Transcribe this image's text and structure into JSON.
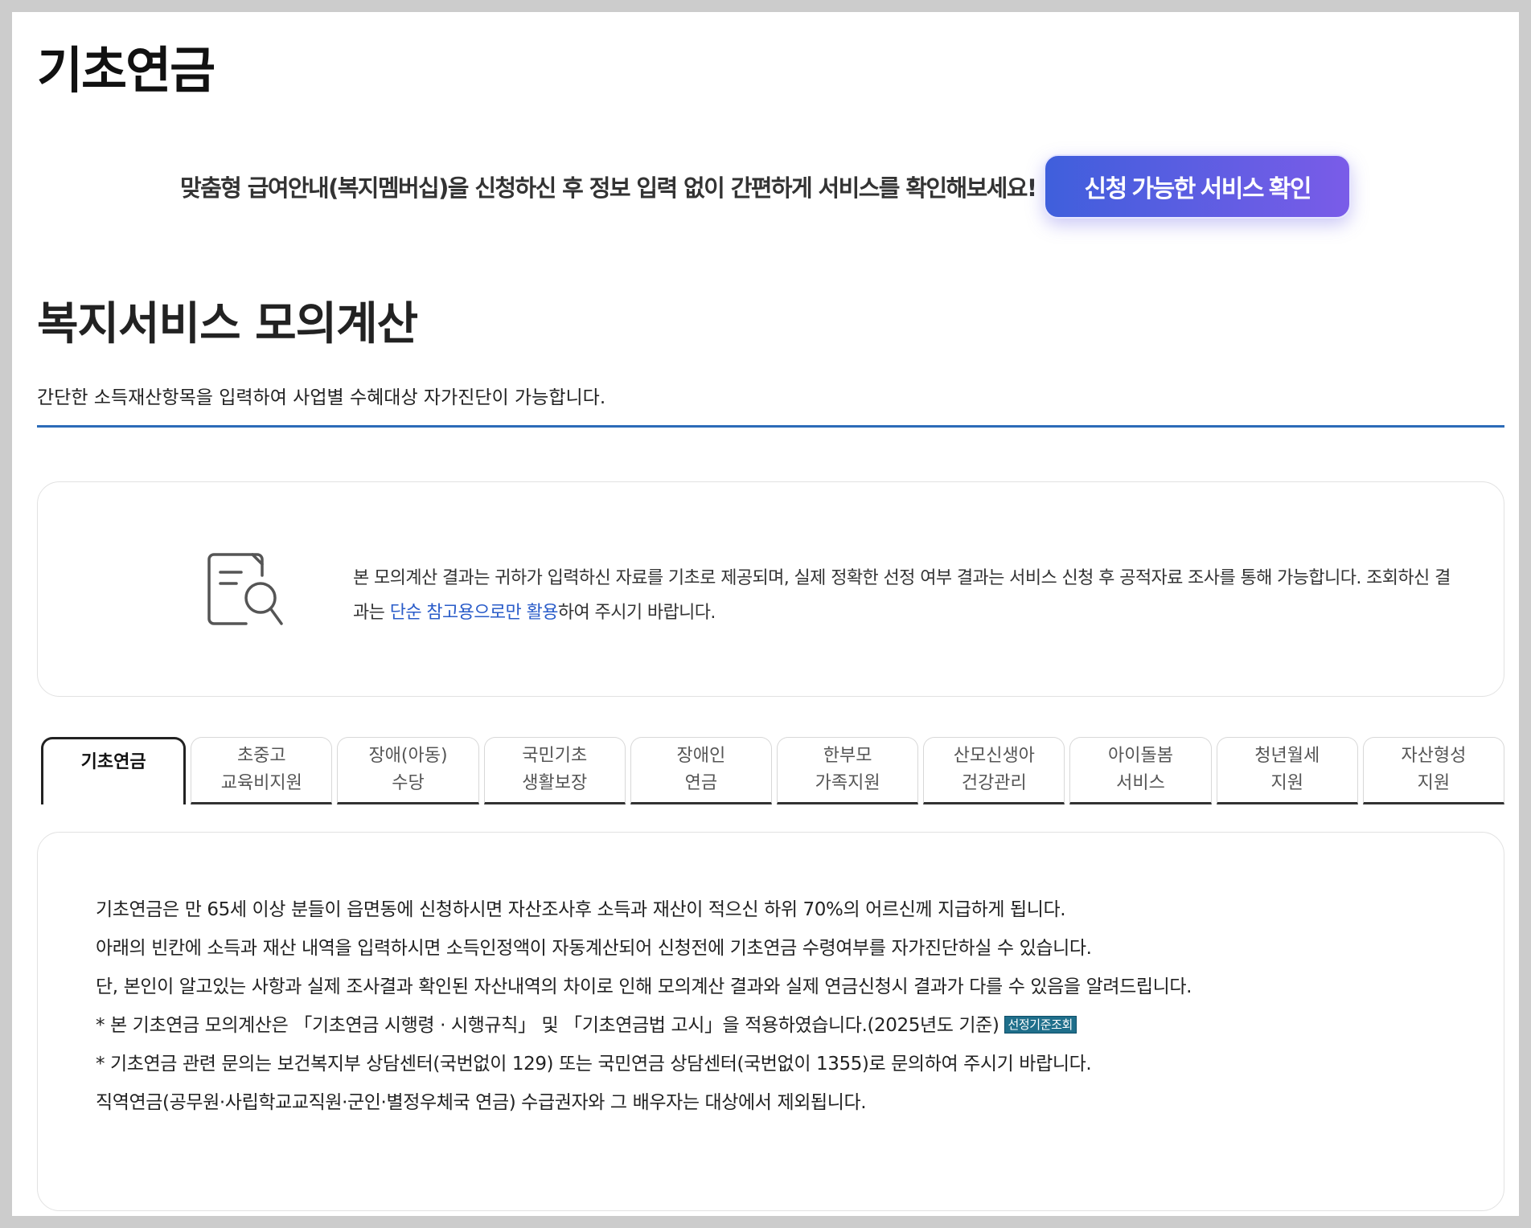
{
  "page": {
    "title": "기초연금"
  },
  "member_banner": {
    "message": "맞춤형 급여안내(복지멤버십)을 신청하신 후 정보 입력 없이 간편하게 서비스를 확인해보세요!",
    "button_label": "신청 가능한 서비스 확인"
  },
  "section": {
    "title": "복지서비스 모의계산",
    "description": "간단한 소득재산항목을 입력하여 사업별 수혜대상 자가진단이 가능합니다."
  },
  "notice": {
    "icon": "document-search-icon",
    "text_before": "본 모의계산 결과는 귀하가 입력하신 자료를 기초로 제공되며, 실제 정확한 선정 여부 결과는 서비스 신청 후 공적자료 조사를 통해 가능합니다. 조회하신 결과는 ",
    "text_highlight": "단순 참고용으로만 활용",
    "text_after": "하여 주시기 바랍니다.",
    "highlight_color": "#2a5cc9"
  },
  "tabs": [
    {
      "label": "기초연금",
      "active": true
    },
    {
      "label": "초중고\n교육비지원",
      "active": false
    },
    {
      "label": "장애(아동)\n수당",
      "active": false
    },
    {
      "label": "국민기초\n생활보장",
      "active": false
    },
    {
      "label": "장애인\n연금",
      "active": false
    },
    {
      "label": "한부모\n가족지원",
      "active": false
    },
    {
      "label": "산모신생아\n건강관리",
      "active": false
    },
    {
      "label": "아이돌봄\n서비스",
      "active": false
    },
    {
      "label": "청년월세\n지원",
      "active": false
    },
    {
      "label": "자산형성\n지원",
      "active": false
    }
  ],
  "content": {
    "lines": [
      "기초연금은 만 65세 이상 분들이 읍면동에 신청하시면 자산조사후 소득과 재산이 적으신 하위 70%의 어르신께 지급하게 됩니다.",
      "아래의 빈칸에 소득과 재산 내역을 입력하시면 소득인정액이 자동계산되어 신청전에 기초연금 수령여부를 자가진단하실 수 있습니다.",
      "단, 본인이 알고있는 사항과 실제 조사결과 확인된 자산내역의 차이로 인해 모의계산 결과와 실제 연금신청시 결과가 다를 수 있음을 알려드립니다.",
      "* 본 기초연금 모의계산은 「기초연금 시행령 · 시행규칙」 및 「기초연금법 고시」을 적용하였습니다.(2025년도 기준)",
      "* 기초연금 관련 문의는 보건복지부 상담센터(국번없이 129) 또는 국민연금 상담센터(국번없이 1355)로 문의하여 주시기 바랍니다.",
      "직역연금(공무원·사립학교교직원·군인·별정우체국 연금) 수급권자와 그 배우자는 대상에서 제외됩니다."
    ],
    "criteria_badge_label": "선정기준조회"
  },
  "colors": {
    "accent_line": "#2b6bb8",
    "cta_gradient_start": "#3f5fdc",
    "cta_gradient_end": "#7a5ce8",
    "badge": "#1f6f8b"
  }
}
